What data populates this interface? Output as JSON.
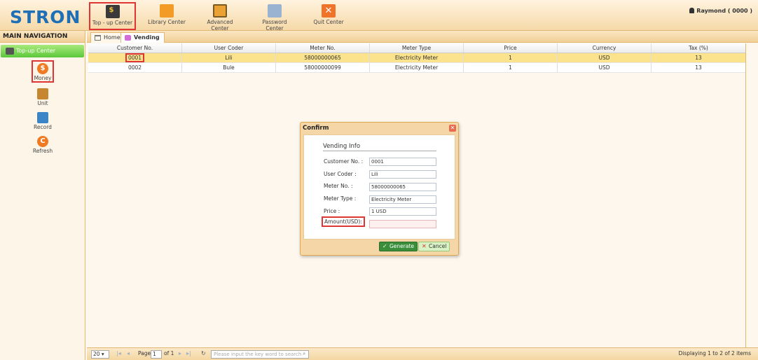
{
  "brand": {
    "logo_text": "STRON"
  },
  "top_nav": [
    {
      "label": "Top - up Center",
      "icon": "dollar-ticket-icon",
      "color": "#3a3a3a"
    },
    {
      "label": "Library Center",
      "icon": "library-folder-icon",
      "color": "#f29b26"
    },
    {
      "label": "Advanced Center",
      "icon": "monitor-icon",
      "color": "#e9a233"
    },
    {
      "label": "Password Center",
      "icon": "password-icon",
      "color": "#6b8fb8"
    },
    {
      "label": "Quit Center",
      "icon": "quit-x-icon",
      "color": "#f0732a"
    }
  ],
  "user": {
    "label": "Raymond ( 0000 )"
  },
  "sidebar": {
    "title": "MAIN NAVIGATION",
    "section": "Top-up Center",
    "items": [
      {
        "label": "Money",
        "icon": "money-icon",
        "color": "#f07a22"
      },
      {
        "label": "Unit",
        "icon": "unit-icon",
        "color": "#c6862f"
      },
      {
        "label": "Record",
        "icon": "record-icon",
        "color": "#3b84c7"
      },
      {
        "label": "Refresh",
        "icon": "refresh-icon",
        "color": "#f07a22"
      }
    ]
  },
  "tabs": [
    {
      "label": "Home",
      "icon": "home-icon"
    },
    {
      "label": "Vending",
      "icon": "vending-icon"
    }
  ],
  "table": {
    "columns": [
      "Customer No.",
      "User Coder",
      "Meter No.",
      "Meter Type",
      "Price",
      "Currency",
      "Tax (%)"
    ],
    "rows": [
      [
        "0001",
        "Lili",
        "58000000065",
        "Electricity Meter",
        "1",
        "USD",
        "13"
      ],
      [
        "0002",
        "Bule",
        "58000000099",
        "Electricity Meter",
        "1",
        "USD",
        "13"
      ]
    ]
  },
  "pager": {
    "page_size": "20",
    "page_label": "Page",
    "page_value": "1",
    "of_label": "of 1",
    "search_placeholder": "Please input the key word to search",
    "display": "Displaying 1 to 2 of 2 items"
  },
  "dialog": {
    "title": "Confirm",
    "section": "Vending Info",
    "fields": [
      {
        "label": "Customer No. :",
        "value": "0001"
      },
      {
        "label": "User Coder :",
        "value": "Lili"
      },
      {
        "label": "Meter No. :",
        "value": "58000000065"
      },
      {
        "label": "Meter Type :",
        "value": "Electricity Meter"
      },
      {
        "label": "Price :",
        "value": "1 USD"
      }
    ],
    "amount_label": "Amount(USD):",
    "amount_value": "",
    "generate_label": "Generate",
    "cancel_label": "Cancel"
  },
  "colors": {
    "accent": "#f1cf96",
    "highlight": "#e03535",
    "selected_row": "#fbe38d",
    "generate": "#3a8e3a"
  }
}
